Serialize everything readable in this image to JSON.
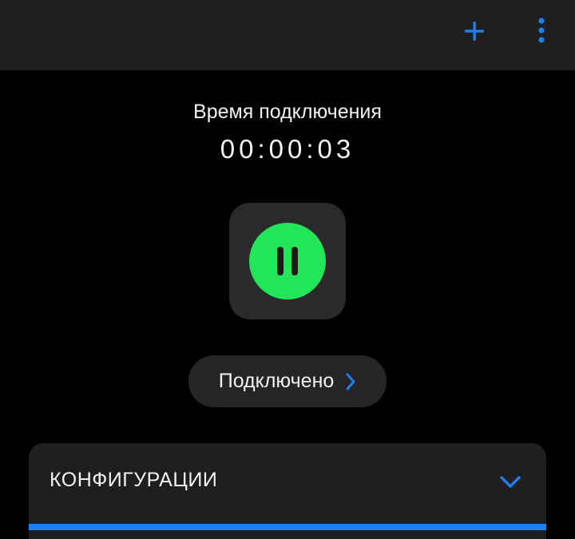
{
  "colors": {
    "accent": "#1e7ff0",
    "connected_green": "#22e55a",
    "pause_bars": "#1a1a1a"
  },
  "header": {
    "add_icon": "plus-icon",
    "menu_icon": "vertical-dots-icon"
  },
  "connection": {
    "time_label": "Время подключения",
    "time_value": "00:00:03",
    "power_icon": "pause-icon"
  },
  "status": {
    "label": "Подключено",
    "icon": "chevron-right-icon"
  },
  "configurations": {
    "title": "КОНФИГУРАЦИИ",
    "icon": "chevron-down-icon"
  }
}
